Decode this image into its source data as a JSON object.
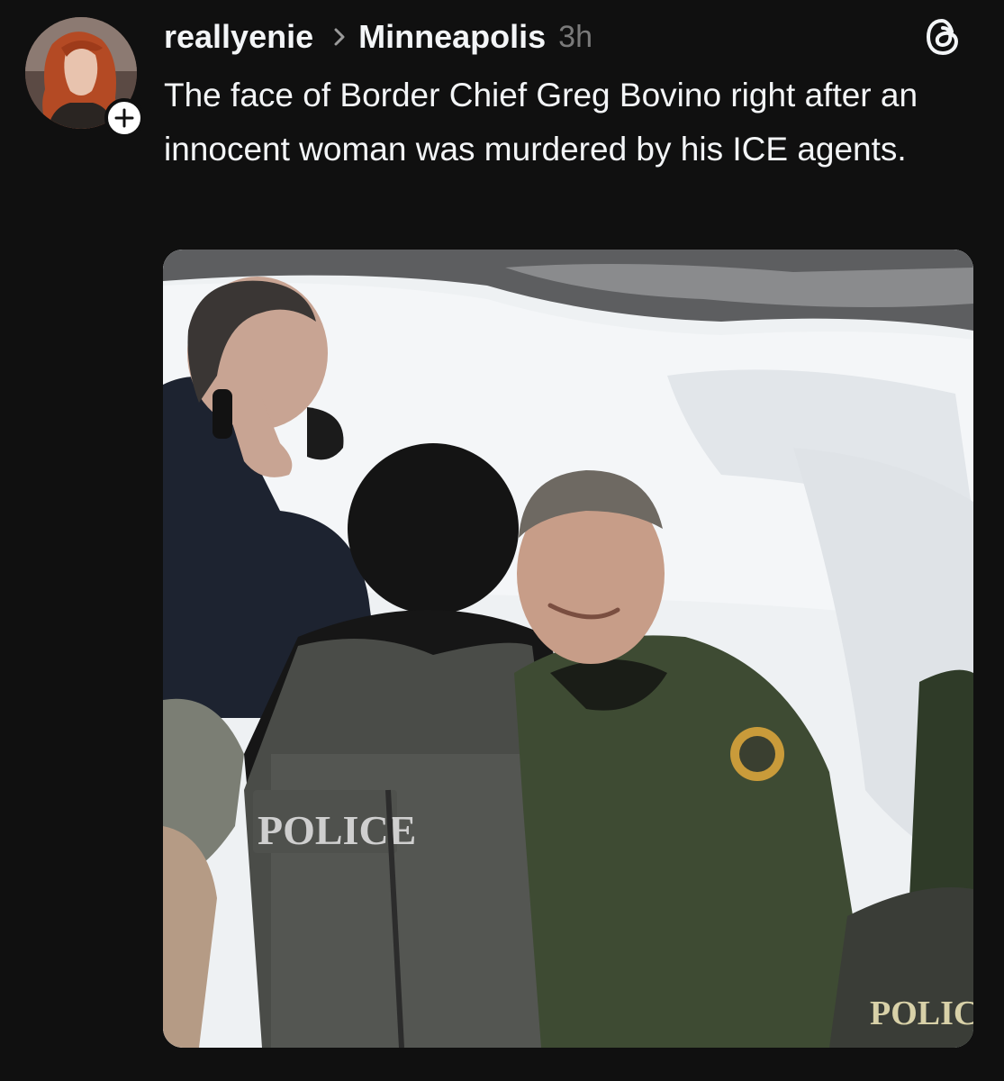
{
  "post": {
    "author": {
      "username": "reallyenie",
      "avatar_icon": "profile-photo"
    },
    "community": "Minneapolis",
    "timestamp": "3h",
    "text": "The face of Border Chief Greg Bovino right after an innocent woman was murdered by his ICE agents.",
    "media": {
      "patch_text_left": "POLICE",
      "patch_text_right": "POLICE"
    }
  },
  "colors": {
    "background": "#101010",
    "text_primary": "#f3f5f7",
    "text_secondary": "#7a7a7a"
  },
  "icons": {
    "follow": "plus-icon",
    "separator": "chevron-right-icon",
    "app": "threads-logo-icon"
  }
}
